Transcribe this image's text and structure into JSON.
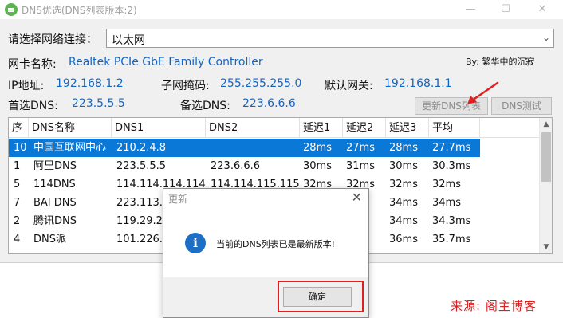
{
  "window": {
    "title": "DNS优选(DNS列表版本:2)",
    "minimize_label": "—",
    "maximize_label": "☐",
    "close_label": "✕"
  },
  "connection": {
    "label": "请选择网络连接：",
    "selected": "以太网",
    "chevron": "⌄"
  },
  "adapter": {
    "label": "网卡名称:",
    "value": "Realtek PCIe GbE Family Controller"
  },
  "author": "By: 繁华中的沉寂",
  "network": {
    "ip_label": "IP地址:",
    "ip_value": "192.168.1.2",
    "mask_label": "子网掩码:",
    "mask_value": "255.255.255.0",
    "gateway_label": "默认网关:",
    "gateway_value": "192.168.1.1",
    "dns1_label": "首选DNS:",
    "dns1_value": "223.5.5.5",
    "dns2_label": "备选DNS:",
    "dns2_value": "223.6.6.6"
  },
  "buttons": {
    "update_list": "更新DNS列表",
    "test_dns": "DNS测试"
  },
  "table": {
    "headers": [
      "序",
      "DNS名称",
      "DNS1",
      "DNS2",
      "延迟1",
      "延迟2",
      "延迟3",
      "平均"
    ],
    "rows": [
      [
        "10",
        "中国互联网中心",
        "210.2.4.8",
        "",
        "28ms",
        "27ms",
        "28ms",
        "27.7ms"
      ],
      [
        "1",
        "阿里DNS",
        "223.5.5.5",
        "223.6.6.6",
        "30ms",
        "31ms",
        "30ms",
        "30.3ms"
      ],
      [
        "5",
        "114DNS",
        "114.114.114.114",
        "114.114.115.115",
        "32ms",
        "32ms",
        "32ms",
        "32ms"
      ],
      [
        "7",
        "BAI DNS",
        "223.113.9",
        "",
        "",
        "",
        "34ms",
        "34ms"
      ],
      [
        "2",
        "腾讯DNS",
        "119.29.29",
        "",
        "",
        "",
        "34ms",
        "34.3ms"
      ],
      [
        "4",
        "DNS派",
        "101.226.4",
        "",
        "",
        "",
        "36ms",
        "35.7ms"
      ]
    ],
    "selected_row": 0
  },
  "dialog": {
    "title": "更新",
    "close_label": "✕",
    "icon_glyph": "i",
    "message": "当前的DNS列表已是最新版本!",
    "ok_label": "确定"
  },
  "watermark": "来源: 阁主博客",
  "colors": {
    "link_blue": "#1565c0",
    "selection": "#0a78d7",
    "highlight_red": "#e02020"
  }
}
